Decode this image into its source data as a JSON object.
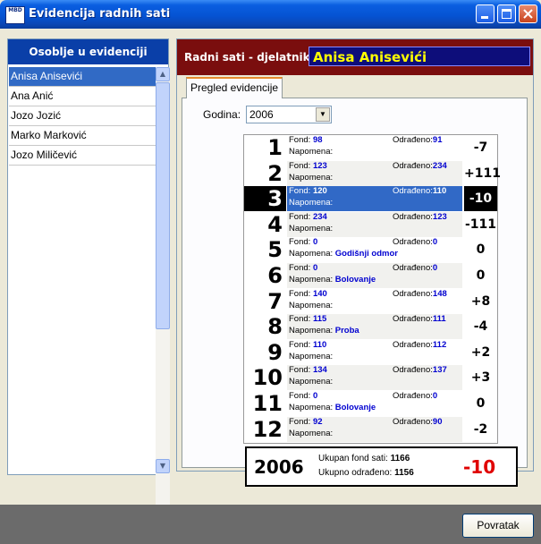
{
  "window": {
    "title": "Evidencija radnih sati",
    "logo_text": "MBD"
  },
  "sidebar": {
    "title": "Osoblje u evidenciji",
    "items": [
      {
        "label": "Anisa Anisevići",
        "selected": true
      },
      {
        "label": "Ana Anić"
      },
      {
        "label": "Jozo Jozić"
      },
      {
        "label": "Marko Marković"
      },
      {
        "label": "Jozo Miličević"
      }
    ]
  },
  "main": {
    "header_label": "Radni sati - djelatnik:",
    "employee_name": "Anisa Anisevići",
    "tab_label": "Pregled evidencije",
    "year_label": "Godina:",
    "year_value": "2006",
    "fond_label": "Fond:",
    "odradeno_label": "Odrađeno:",
    "napomena_label": "Napomena:",
    "months": [
      {
        "num": "1",
        "fond": "98",
        "odradeno": "91",
        "napomena": "",
        "diff": "-7"
      },
      {
        "num": "2",
        "fond": "123",
        "odradeno": "234",
        "napomena": "",
        "diff": "+111"
      },
      {
        "num": "3",
        "fond": "120",
        "odradeno": "110",
        "napomena": "",
        "diff": "-10",
        "selected": true
      },
      {
        "num": "4",
        "fond": "234",
        "odradeno": "123",
        "napomena": "",
        "diff": "-111"
      },
      {
        "num": "5",
        "fond": "0",
        "odradeno": "0",
        "napomena": "Godišnji odmor",
        "diff": "0"
      },
      {
        "num": "6",
        "fond": "0",
        "odradeno": "0",
        "napomena": "Bolovanje",
        "diff": "0"
      },
      {
        "num": "7",
        "fond": "140",
        "odradeno": "148",
        "napomena": "",
        "diff": "+8"
      },
      {
        "num": "8",
        "fond": "115",
        "odradeno": "111",
        "napomena": "Proba",
        "diff": "-4"
      },
      {
        "num": "9",
        "fond": "110",
        "odradeno": "112",
        "napomena": "",
        "diff": "+2"
      },
      {
        "num": "10",
        "fond": "134",
        "odradeno": "137",
        "napomena": "",
        "diff": "+3"
      },
      {
        "num": "11",
        "fond": "0",
        "odradeno": "0",
        "napomena": "Bolovanje",
        "diff": "0"
      },
      {
        "num": "12",
        "fond": "92",
        "odradeno": "90",
        "napomena": "",
        "diff": "-2"
      }
    ],
    "summary": {
      "year": "2006",
      "fond_label": "Ukupan fond sati:",
      "fond_total": "1166",
      "odradeno_label": "Ukupno odrađeno:",
      "odradeno_total": "1156",
      "diff": "-10"
    }
  },
  "footer": {
    "back_label": "Povratak"
  }
}
